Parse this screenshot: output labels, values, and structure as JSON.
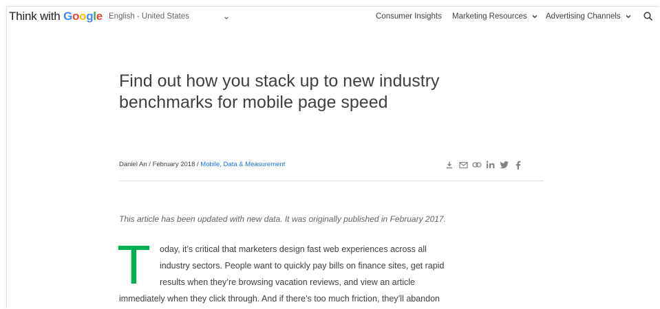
{
  "header": {
    "logo_prefix": "Think with ",
    "logo_brand_letters": [
      "G",
      "o",
      "o",
      "g",
      "l",
      "e"
    ],
    "logo_brand_colors": [
      "#4285F4",
      "#EA4335",
      "#FBBC05",
      "#4285F4",
      "#34A853",
      "#EA4335"
    ],
    "language": "English - United States",
    "nav": {
      "consumer_insights": "Consumer Insights",
      "marketing_resources": "Marketing Resources",
      "advertising_channels": "Advertising Channels"
    }
  },
  "article": {
    "title": "Find out how you stack up to new industry benchmarks for mobile page speed",
    "byline_prefix": "Daniel An / February 2018 / ",
    "byline_categories": "Mobile, Data & Measurement",
    "share_icons": [
      "download-icon",
      "email-icon",
      "link-icon",
      "linkedin-icon",
      "twitter-icon",
      "facebook-icon"
    ],
    "note": "This article has been updated with new data. It was originally published in February 2017.",
    "dropcap": "T",
    "paragraph_lines": [
      "oday, it’s critical that marketers design fast web experiences across all",
      "industry sectors. People want to quickly pay bills on finance sites, get rapid",
      "results when they’re browsing vacation reviews, and view an article",
      "immediately when they click through. And if there’s too much friction, they’ll abandon"
    ],
    "accent_color": "#00b050",
    "link_color": "#1a73e8"
  }
}
